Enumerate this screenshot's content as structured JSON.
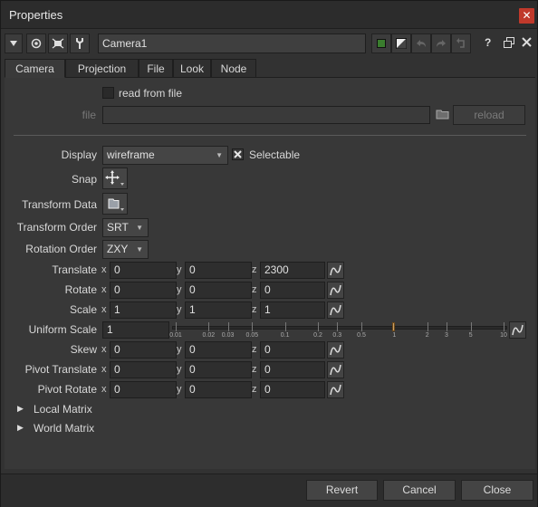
{
  "window": {
    "title": "Properties",
    "close_glyph": "✕"
  },
  "toolbar": {
    "node_name": "Camera1",
    "help_glyph": "?"
  },
  "tabs": [
    "Camera",
    "Projection",
    "File",
    "Look",
    "Node"
  ],
  "read_from_file": {
    "label": "read from file",
    "checked": false
  },
  "file": {
    "label": "file",
    "value": "",
    "reload_label": "reload"
  },
  "display": {
    "label": "Display",
    "value": "wireframe",
    "selectable_label": "Selectable",
    "selectable_checked": true
  },
  "snap": {
    "label": "Snap"
  },
  "transform_data": {
    "label": "Transform Data"
  },
  "transform_order": {
    "label": "Transform Order",
    "value": "SRT"
  },
  "rotation_order": {
    "label": "Rotation Order",
    "value": "ZXY"
  },
  "axes": {
    "x": "x",
    "y": "y",
    "z": "z"
  },
  "knobs": [
    {
      "label": "Translate",
      "x": "0",
      "y": "0",
      "z": "2300"
    },
    {
      "label": "Rotate",
      "x": "0",
      "y": "0",
      "z": "0"
    },
    {
      "label": "Scale",
      "x": "1",
      "y": "1",
      "z": "1"
    }
  ],
  "uniform_scale": {
    "label": "Uniform Scale",
    "value": "1",
    "ticks": [
      "0.01",
      "0.02",
      "0.03",
      "0.05",
      "0.1",
      "0.2",
      "0.3",
      "0.5",
      "1",
      "2",
      "3",
      "5",
      "10"
    ]
  },
  "knobs2": [
    {
      "label": "Skew",
      "x": "0",
      "y": "0",
      "z": "0"
    },
    {
      "label": "Pivot Translate",
      "x": "0",
      "y": "0",
      "z": "0"
    },
    {
      "label": "Pivot Rotate",
      "x": "0",
      "y": "0",
      "z": "0"
    }
  ],
  "groups": {
    "local": "Local Matrix",
    "world": "World Matrix"
  },
  "footer": {
    "revert": "Revert",
    "cancel": "Cancel",
    "close": "Close"
  },
  "colors": {
    "accent_green": "#3a7d2e",
    "close_red": "#c0392b",
    "slider_handle": "#c8a16a"
  }
}
